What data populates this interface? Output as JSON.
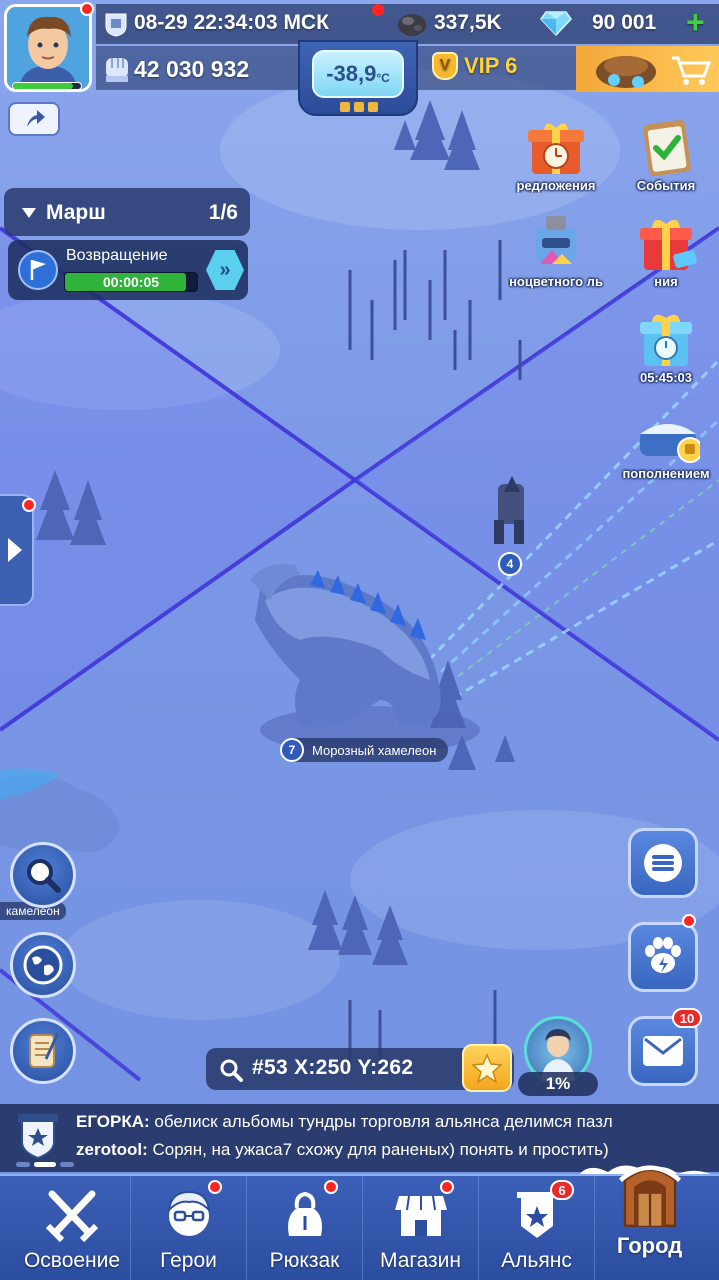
{
  "hud": {
    "datetime": "08-29 22:34:03 МСК",
    "ore": "337,5K",
    "diamonds": "90 001",
    "power": "42 030 932",
    "temperature_value": "-38,9",
    "temperature_unit": "°C",
    "vip": "VIP 6",
    "vip_badge": "V",
    "add_symbol": "+"
  },
  "avatar": {
    "hp_fraction": 0.88
  },
  "march": {
    "title": "Марш",
    "count": "1/6",
    "status": "Возвращение",
    "timer": "00:00:05",
    "progress_fraction": 0.92,
    "speedup_symbol": "»"
  },
  "events": [
    {
      "label": "редложения",
      "icon": "gift-clock-icon"
    },
    {
      "label": "События",
      "icon": "checklist-icon"
    },
    {
      "label": "ноцветного ль",
      "icon": "forge-machine-icon"
    },
    {
      "label": "ния",
      "icon": "gift-box-icon"
    },
    {
      "label": "05:45:03",
      "icon": "gift-timer-icon"
    },
    {
      "label": "пополнением",
      "icon": "recharge-chest-icon"
    }
  ],
  "map": {
    "monster_label": "Морозный хамелеон",
    "monster_level": "7",
    "troop_level": "4",
    "left_label": "камелеон"
  },
  "coords": {
    "text": "#53 X:250  Y:262"
  },
  "hero": {
    "percent": "1%"
  },
  "mail": {
    "badge": "10"
  },
  "chat": {
    "line1_user": "ЕГОРКА:",
    "line1_text": " обелиск альбомы тундры торговля альянса делимся пазл",
    "line2_user": "zerotool:",
    "line2_text": " Сорян, на ужаса7 схожу для раненых) понять и простить)"
  },
  "nav": {
    "items": [
      {
        "label": "Освоение",
        "icon": "swords-icon"
      },
      {
        "label": "Герои",
        "icon": "hero-face-icon"
      },
      {
        "label": "Рюкзак",
        "icon": "backpack-icon"
      },
      {
        "label": "Магазин",
        "icon": "shop-icon"
      },
      {
        "label": "Альянс",
        "icon": "alliance-banner-icon",
        "badge": "6"
      },
      {
        "label": "Город",
        "icon": "city-door-icon"
      }
    ]
  },
  "colors": {
    "map_blue": "#7b98e6",
    "zone_line": "#4a3fd8",
    "hud_dark": "#283a6e",
    "accent_green": "#2fb33b",
    "vip_gold": "#ffd23a",
    "notify_red": "#ff2424"
  }
}
